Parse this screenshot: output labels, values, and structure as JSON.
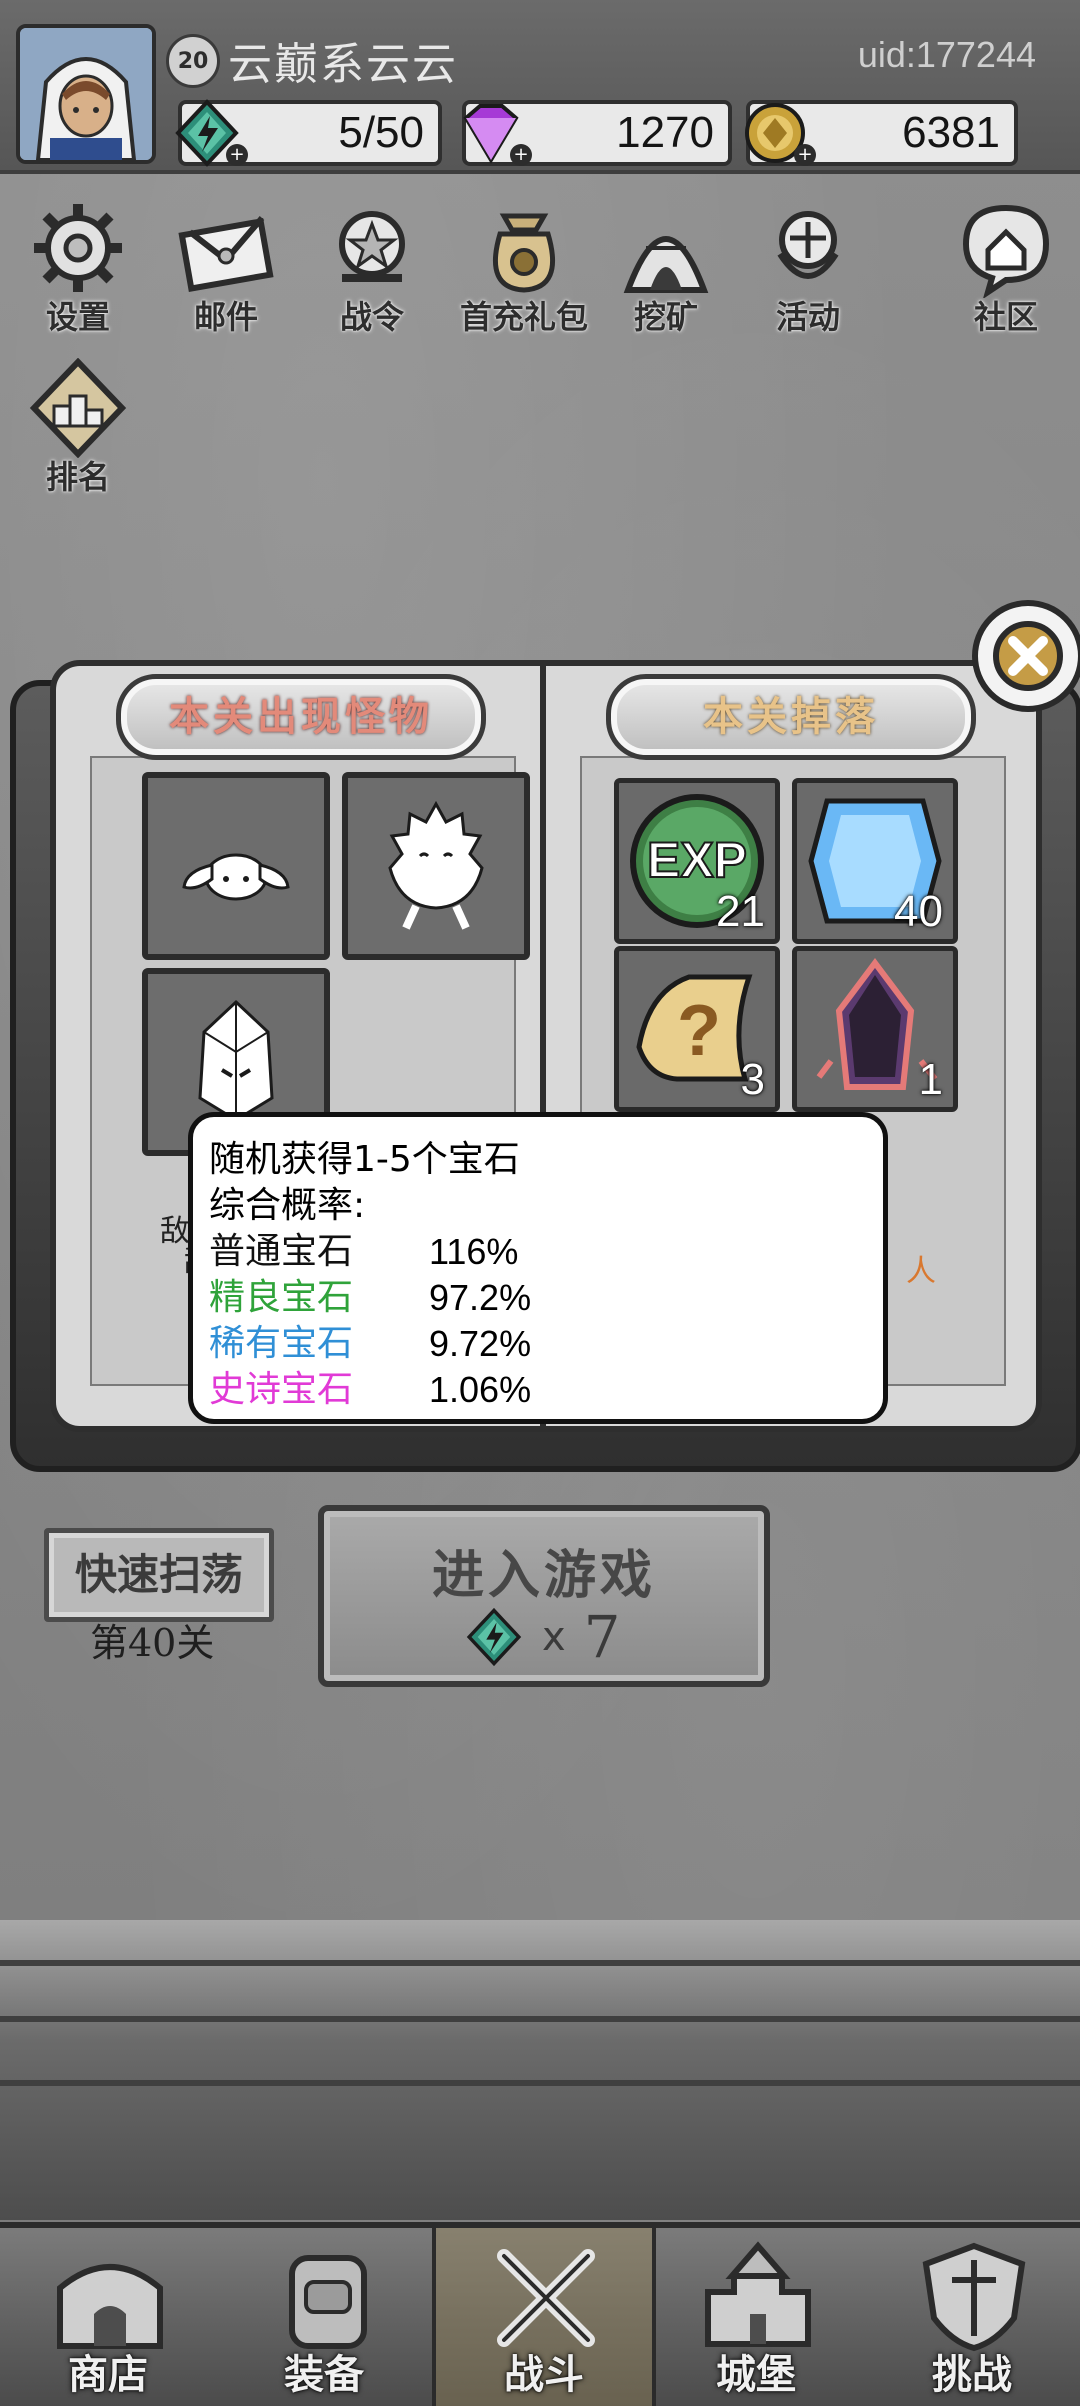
{
  "profile": {
    "level": "20",
    "nickname": "云巅系云云",
    "uid": "uid:177244",
    "resources": {
      "energy": "5/50",
      "gems": "1270",
      "gold": "6381"
    }
  },
  "menu": [
    {
      "label": "设置",
      "icon": "gear-icon"
    },
    {
      "label": "邮件",
      "icon": "mail-icon"
    },
    {
      "label": "战令",
      "icon": "battle-pass-icon"
    },
    {
      "label": "首充礼包",
      "icon": "gift-bag-icon"
    },
    {
      "label": "挖矿",
      "icon": "mine-icon"
    },
    {
      "label": "活动",
      "icon": "event-icon"
    },
    {
      "label": "社区",
      "icon": "community-icon"
    },
    {
      "label": "排名",
      "icon": "ranking-icon"
    }
  ],
  "panel": {
    "monsters_title": "本关出现怪物",
    "drops_title": "本关掉落",
    "monsters": [
      "bunny-monster-icon",
      "spiky-monster-icon",
      "crystal-golem-icon"
    ],
    "drops": [
      {
        "icon": "exp-icon",
        "count": "21"
      },
      {
        "icon": "blue-gem-icon",
        "count": "40"
      },
      {
        "icon": "scroll-icon",
        "count": "3"
      },
      {
        "icon": "dark-crystal-icon",
        "count": "1"
      }
    ],
    "partial_left_1": "敌",
    "partial_left_2": "敌",
    "partial_right": "人"
  },
  "tooltip": {
    "line1": "随机获得1-5个宝石",
    "line2": "综合概率:",
    "rows": [
      {
        "name": "普通宝石",
        "value": "116%",
        "color": "#111111"
      },
      {
        "name": "精良宝石",
        "value": "97.2%",
        "color": "#2fa33a"
      },
      {
        "name": "稀有宝石",
        "value": "9.72%",
        "color": "#2f8fd6"
      },
      {
        "name": "史诗宝石",
        "value": "1.06%",
        "color": "#e13ad6"
      }
    ]
  },
  "actions": {
    "sweep_label": "快速扫荡",
    "stage_label": "第40关",
    "enter_label": "进入游戏",
    "cost_x": "x",
    "cost_value": "7"
  },
  "nav": [
    {
      "label": "商店",
      "icon": "shop-icon"
    },
    {
      "label": "装备",
      "icon": "backpack-icon"
    },
    {
      "label": "战斗",
      "icon": "crossed-swords-icon"
    },
    {
      "label": "城堡",
      "icon": "castle-icon"
    },
    {
      "label": "挑战",
      "icon": "challenge-icon"
    }
  ],
  "colors": {
    "energy_gem": "#2d8f7a",
    "purple_gem": "#a63ad6",
    "gold_coin": "#c9a23a",
    "blue_gem": "#6ab8f5"
  }
}
